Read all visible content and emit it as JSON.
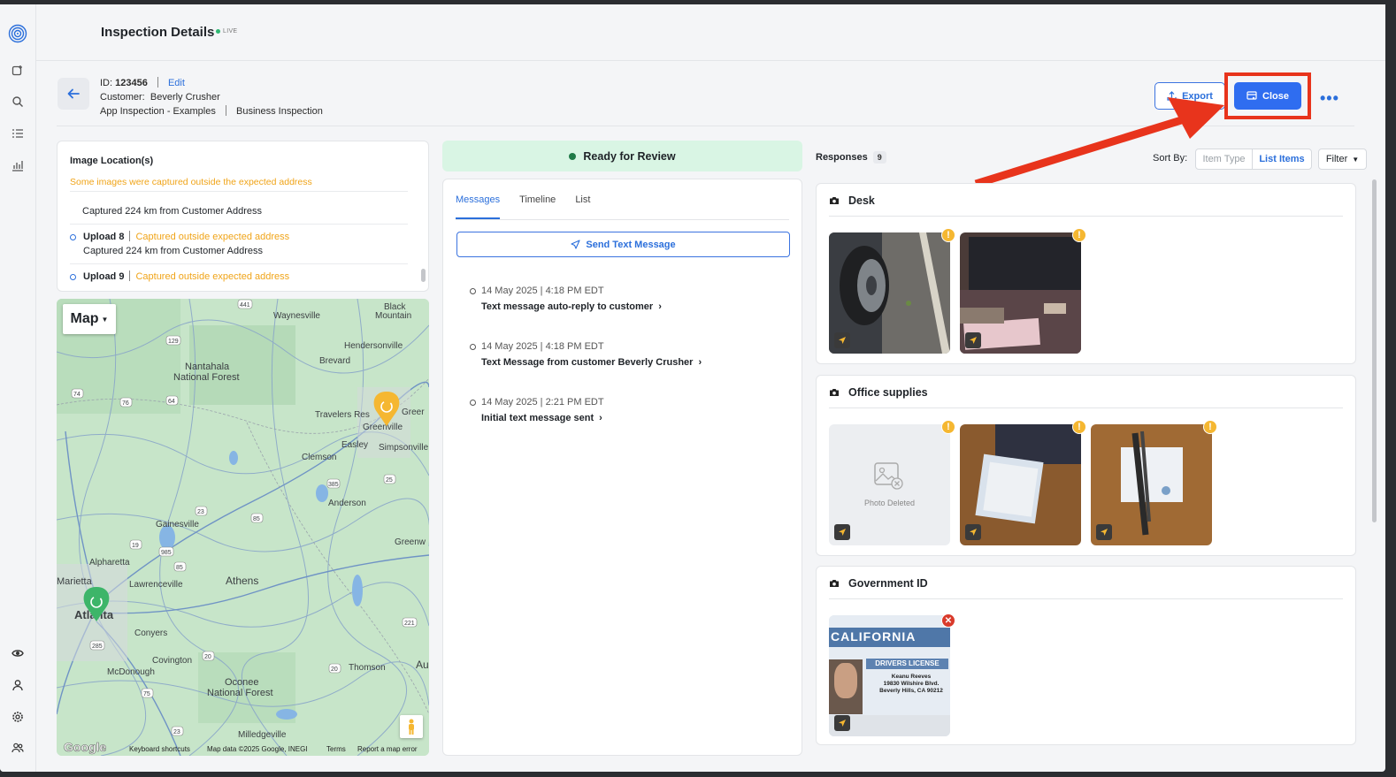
{
  "header": {
    "title": "Inspection Details",
    "live_label": "LIVE"
  },
  "inspection": {
    "id_label": "ID:",
    "id_value": "123456",
    "edit_label": "Edit",
    "customer_label": "Customer:",
    "customer_name": "Beverly Crusher",
    "template": "App Inspection - Examples",
    "type": "Business Inspection"
  },
  "actions": {
    "export_label": "Export",
    "close_label": "Close",
    "more_label": "•••"
  },
  "image_locations": {
    "title": "Image Location(s)",
    "warning": "Some images were captured outside the expected address",
    "items": [
      {
        "upload": "",
        "status": "",
        "detail": "Captured 224 km from Customer Address"
      },
      {
        "upload": "Upload 8",
        "status": "Captured outside expected address",
        "detail": "Captured 224 km from Customer Address"
      },
      {
        "upload": "Upload 9",
        "status": "Captured outside expected address",
        "detail": ""
      }
    ]
  },
  "map": {
    "type_label": "Map",
    "labels": [
      "Waynesville",
      "Black Mountain",
      "Hendersonville",
      "Brevard",
      "Nantahala National Forest",
      "Travelers Rest",
      "Greer",
      "Greenville",
      "Simpsonville",
      "Easley",
      "Clemson",
      "Anderson",
      "Gainesville",
      "Greenw",
      "Alpharetta",
      "Marietta",
      "Lawrenceville",
      "Athens",
      "Atlanta",
      "Conyers",
      "Covington",
      "McDonough",
      "Oconee National Forest",
      "Thomson",
      "Au",
      "Milledgeville"
    ],
    "shields": [
      "441",
      "129",
      "74",
      "64",
      "76",
      "385",
      "25",
      "23",
      "85",
      "19",
      "985",
      "85",
      "20",
      "285",
      "221",
      "20",
      "75",
      "23"
    ],
    "footer": {
      "brand": "Google",
      "shortcuts": "Keyboard shortcuts",
      "data": "Map data ©2025 Google, INEGI",
      "terms": "Terms",
      "report": "Report a map error"
    }
  },
  "status": {
    "label": "Ready for Review"
  },
  "messages": {
    "tabs": [
      "Messages",
      "Timeline",
      "List"
    ],
    "send_label": "Send Text Message",
    "events": [
      {
        "timestamp": "14 May 2025 | 4:18 PM EDT",
        "text": "Text message auto-reply to customer"
      },
      {
        "timestamp": "14 May 2025 | 4:18 PM EDT",
        "text": "Text Message from customer Beverly Crusher"
      },
      {
        "timestamp": "14 May 2025 | 2:21 PM EDT",
        "text": "Initial text message sent"
      }
    ]
  },
  "responses": {
    "title": "Responses",
    "count": "9",
    "sort_by_label": "Sort By:",
    "sort_options": [
      "Item Type",
      "List Items"
    ],
    "filter_label": "Filter",
    "sections": [
      {
        "title": "Desk"
      },
      {
        "title": "Office supplies",
        "deleted_label": "Photo Deleted"
      },
      {
        "title": "Government ID"
      }
    ],
    "license": {
      "state": "CALIFORNIA",
      "doc": "DRIVERS LICENSE",
      "name": "Keanu Reeves",
      "address1": "19830 Wilshire Blvd.",
      "address2": "Beverly Hills, CA 90212"
    }
  },
  "colors": {
    "accent": "#2f6df0",
    "warning": "#f0a418",
    "status_bg": "#d9f5e4",
    "annotation": "#e8341c"
  }
}
